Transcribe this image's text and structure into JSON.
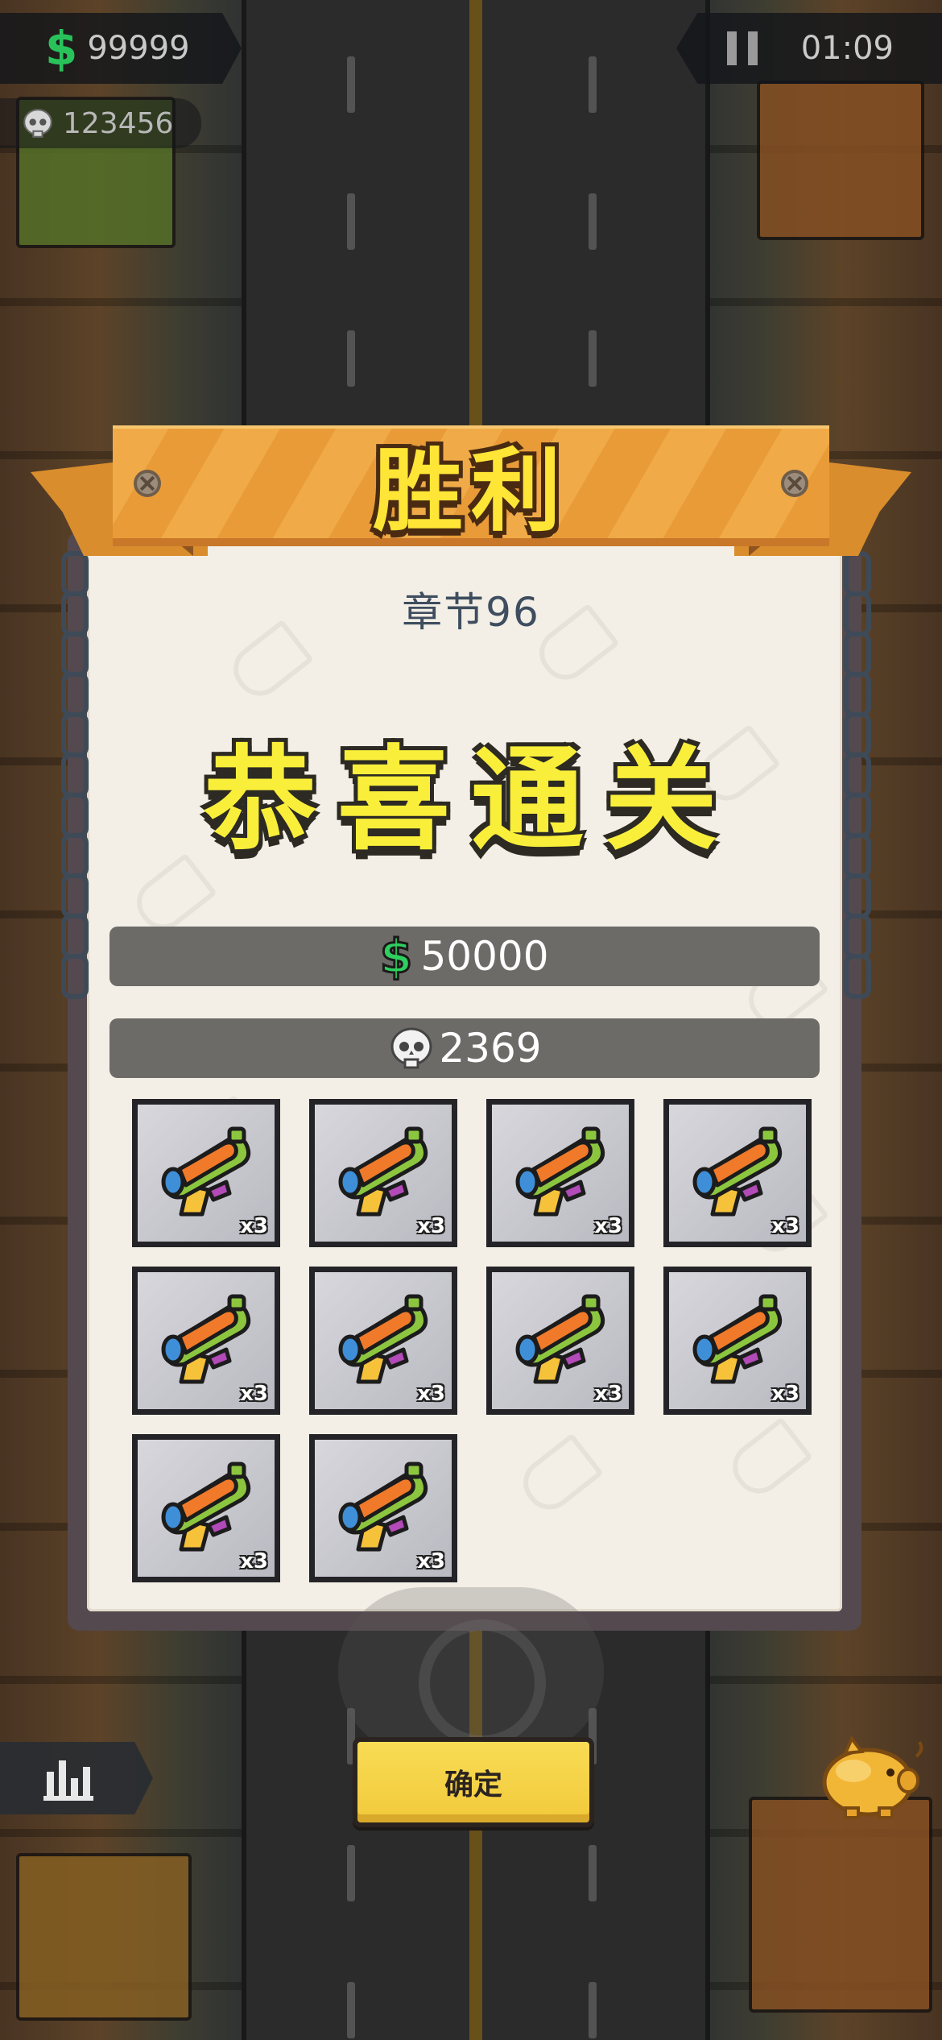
{
  "hud": {
    "money": "99999",
    "kills": "123456",
    "timer": "01:09"
  },
  "dialog": {
    "title": "胜利",
    "chapter": "章节96",
    "headline": "恭喜通关",
    "cash_reward": "50000",
    "kill_reward": "2369",
    "items": [
      {
        "name": "water-gun",
        "qty": "x3"
      },
      {
        "name": "water-gun",
        "qty": "x3"
      },
      {
        "name": "water-gun",
        "qty": "x3"
      },
      {
        "name": "water-gun",
        "qty": "x3"
      },
      {
        "name": "water-gun",
        "qty": "x3"
      },
      {
        "name": "water-gun",
        "qty": "x3"
      },
      {
        "name": "water-gun",
        "qty": "x3"
      },
      {
        "name": "water-gun",
        "qty": "x3"
      },
      {
        "name": "water-gun",
        "qty": "x3"
      },
      {
        "name": "water-gun",
        "qty": "x3"
      }
    ],
    "confirm_label": "确定"
  },
  "icons": {
    "money": "dollar-icon",
    "kills": "skull-icon",
    "pause": "pause-icon",
    "stats": "bar-chart-icon",
    "piggy": "piggy-bank-icon"
  },
  "colors": {
    "cash_green": "#29c25a",
    "title_yellow": "#ffe536",
    "ribbon_orange": "#f0aa48",
    "button_yellow": "#f8dc54"
  }
}
